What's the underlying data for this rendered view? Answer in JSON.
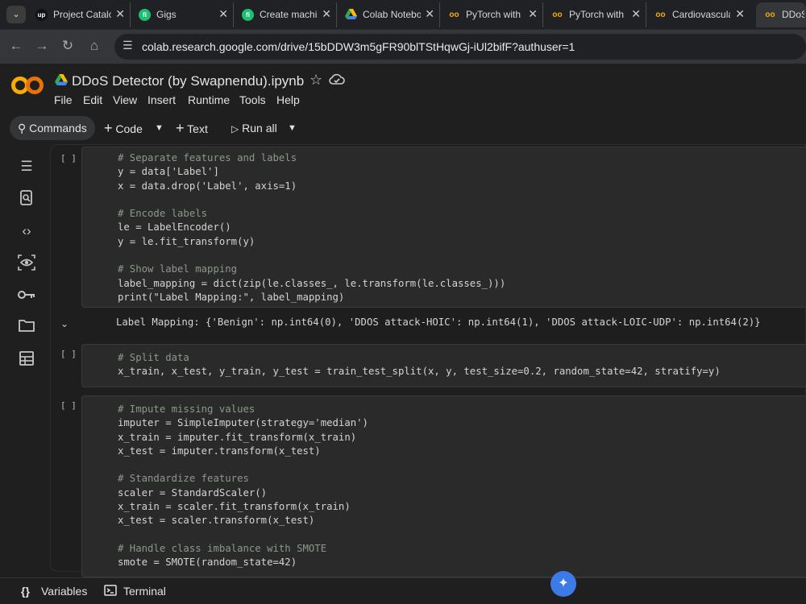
{
  "browser": {
    "tabs": [
      {
        "title": "Project Catalog",
        "icon": "upwork-icon"
      },
      {
        "title": "Gigs",
        "icon": "fiverr-icon"
      },
      {
        "title": "Create machine",
        "icon": "fiverr-icon"
      },
      {
        "title": "Colab Notebooks",
        "icon": "drive-icon"
      },
      {
        "title": "PyTorch with",
        "icon": "colab-icon"
      },
      {
        "title": "PyTorch with",
        "icon": "colab-icon"
      },
      {
        "title": "Cardiovascular",
        "icon": "colab-icon"
      },
      {
        "title": "DDoS",
        "icon": "colab-icon"
      }
    ],
    "url": "colab.research.google.com/drive/15bDDW3m5gFR90blTStHqwGj-iUl2bifF?authuser=1"
  },
  "notebook": {
    "title": "DDoS Detector (by Swapnendu).ipynb",
    "menu": [
      "File",
      "Edit",
      "View",
      "Insert",
      "Runtime",
      "Tools",
      "Help"
    ]
  },
  "toolbar": {
    "commands": "Commands",
    "code": "Code",
    "text": "Text",
    "run_all": "Run all"
  },
  "cells": [
    {
      "bracket": "[ ]",
      "lines": [
        {
          "t": "# Separate features and labels",
          "k": "cm"
        },
        {
          "t": "y = data['Label']"
        },
        {
          "t": "x = data.drop('Label', axis=1)"
        },
        {
          "t": ""
        },
        {
          "t": "# Encode labels",
          "k": "cm"
        },
        {
          "t": "le = LabelEncoder()"
        },
        {
          "t": "y = le.fit_transform(y)"
        },
        {
          "t": ""
        },
        {
          "t": "# Show label mapping",
          "k": "cm"
        },
        {
          "t": "label_mapping = dict(zip(le.classes_, le.transform(le.classes_)))"
        },
        {
          "t": "print(\"Label Mapping:\", label_mapping)"
        }
      ],
      "output": "Label Mapping: {'Benign': np.int64(0), 'DDOS attack-HOIC': np.int64(1), 'DDOS attack-LOIC-UDP': np.int64(2)}"
    },
    {
      "bracket": "[ ]",
      "lines": [
        {
          "t": "# Split data",
          "k": "cm"
        },
        {
          "t": "x_train, x_test, y_train, y_test = train_test_split(x, y, test_size=0.2, random_state=42, stratify=y)"
        }
      ]
    },
    {
      "bracket": "[ ]",
      "lines": [
        {
          "t": "# Impute missing values",
          "k": "cm"
        },
        {
          "t": "imputer = SimpleImputer(strategy='median')"
        },
        {
          "t": "x_train = imputer.fit_transform(x_train)"
        },
        {
          "t": "x_test = imputer.transform(x_test)"
        },
        {
          "t": ""
        },
        {
          "t": "# Standardize features",
          "k": "cm"
        },
        {
          "t": "scaler = StandardScaler()"
        },
        {
          "t": "x_train = scaler.fit_transform(x_train)"
        },
        {
          "t": "x_test = scaler.transform(x_test)"
        },
        {
          "t": ""
        },
        {
          "t": "# Handle class imbalance with SMOTE",
          "k": "cm"
        },
        {
          "t": "smote = SMOTE(random_state=42)"
        }
      ]
    }
  ],
  "bottom": {
    "variables": "Variables",
    "terminal": "Terminal"
  }
}
